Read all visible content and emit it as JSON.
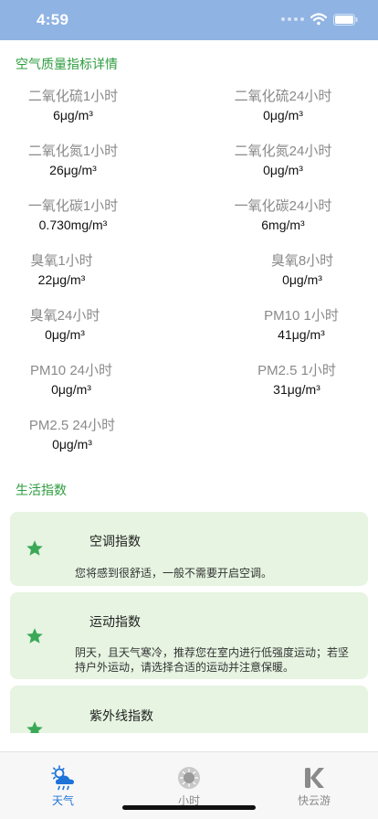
{
  "status_bar": {
    "time": "4:59"
  },
  "air_quality": {
    "title": "空气质量指标详情",
    "metrics": [
      {
        "label": "二氧化硫1小时",
        "value": "6μg/m³"
      },
      {
        "label": "二氧化硫24小时",
        "value": "0μg/m³"
      },
      {
        "label": "二氧化氮1小时",
        "value": "26μg/m³"
      },
      {
        "label": "二氧化氮24小时",
        "value": "0μg/m³"
      },
      {
        "label": "一氧化碳1小时",
        "value": "0.730mg/m³"
      },
      {
        "label": "一氧化碳24小时",
        "value": "6mg/m³"
      },
      {
        "label": "臭氧1小时",
        "value": "22μg/m³"
      },
      {
        "label": "臭氧8小时",
        "value": "0μg/m³"
      },
      {
        "label": "臭氧24小时",
        "value": "0μg/m³"
      },
      {
        "label": "PM10 1小时",
        "value": "41μg/m³"
      },
      {
        "label": "PM10 24小时",
        "value": "0μg/m³"
      },
      {
        "label": "PM2.5 1小时",
        "value": "31μg/m³"
      },
      {
        "label": "PM2.5 24小时",
        "value": "0μg/m³"
      }
    ]
  },
  "life_index": {
    "title": "生活指数",
    "cards": [
      {
        "title": "空调指数",
        "desc": "您将感到很舒适，一般不需要开启空调。"
      },
      {
        "title": "运动指数",
        "desc": "阴天，且天气寒冷，推荐您在室内进行低强度运动；若坚持户外运动，请选择合适的运动并注意保暖。"
      },
      {
        "title": "紫外线指数",
        "desc": ""
      }
    ]
  },
  "tab_bar": {
    "tabs": [
      {
        "label": "天气",
        "icon": "weather-cloud-icon",
        "active": true
      },
      {
        "label": "小时",
        "icon": "sun-icon",
        "active": false
      },
      {
        "label": "快云游",
        "icon": "k-logo-icon",
        "active": false
      }
    ],
    "active_color": "#1e73d8",
    "inactive_color": "#8a8a8a"
  },
  "colors": {
    "status_bar": "#8fb3e3",
    "section_title": "#2e9d3f",
    "card_bg": "#e6f4e1",
    "star": "#3aa957"
  }
}
